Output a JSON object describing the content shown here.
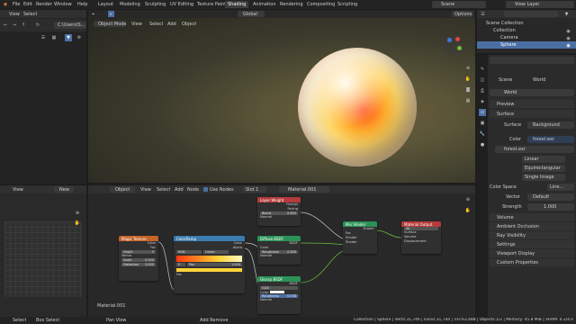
{
  "topbar": {
    "menus": [
      "File",
      "Edit",
      "Render",
      "Window",
      "Help"
    ],
    "workspaces": [
      "Layout",
      "Modeling",
      "Sculpting",
      "UV Editing",
      "Texture Paint",
      "Shading",
      "Animation",
      "Rendering",
      "Compositing",
      "Scripting"
    ],
    "active_workspace": "Shading",
    "scene": "Scene",
    "view_layer": "View Layer"
  },
  "file_browser": {
    "view_label": "View",
    "select_label": "Select",
    "path": "C:\\Users\\S..."
  },
  "viewport": {
    "mode": "Object Mode",
    "menus": [
      "View",
      "Select",
      "Add",
      "Object"
    ],
    "transform": "Global",
    "options": "Options"
  },
  "image_editor": {
    "view_label": "View",
    "new_label": "New"
  },
  "node_editor": {
    "editor_mode": "Object",
    "menus": [
      "View",
      "Select",
      "Add",
      "Node"
    ],
    "use_nodes": "Use Nodes",
    "slot": "Slot 1",
    "material": "Material.001",
    "material_footer": "Material.001"
  },
  "nodes": {
    "magic": {
      "title": "Magic Texture",
      "out_color": "Color",
      "out_fac": "Fac",
      "depth_label": "Depth",
      "depth_value": "3",
      "vector": "Vector",
      "scale_label": "Scale",
      "scale_value": "5.200",
      "distortion_label": "Distortion",
      "distortion_value": "3.000"
    },
    "ramp": {
      "title": "ColorRamp",
      "out_color": "Color",
      "out_alpha": "Alpha",
      "mode": "RGB",
      "interp": "Linear",
      "pos_label": "Pos",
      "pos_value": "1.000",
      "index": "0",
      "in_fac": "Fac"
    },
    "layer_weight": {
      "title": "Layer Weight",
      "out_fresnel": "Fresnel",
      "out_facing": "Facing",
      "blend_label": "Blend",
      "blend_value": "0.650",
      "normal": "Normal"
    },
    "diffuse": {
      "title": "Diffuse BSDF",
      "out": "BSDF",
      "color": "Color",
      "rough_label": "Roughness",
      "rough_value": "0.000",
      "normal": "Normal"
    },
    "glossy": {
      "title": "Glossy BSDF",
      "out": "BSDF",
      "dist": "GGX",
      "color": "Color",
      "rough_label": "Roughness",
      "rough_value": "0.538",
      "normal": "Normal"
    },
    "mix": {
      "title": "Mix Shader",
      "out": "Shader",
      "fac": "Fac",
      "shader1": "Shader",
      "shader2": "Shader"
    },
    "output": {
      "title": "Material Output",
      "target": "All",
      "surface": "Surface",
      "volume": "Volume",
      "displacement": "Displacement"
    }
  },
  "outliner": {
    "collection": "Scene Collection",
    "items": [
      "Collection",
      "Camera",
      "Sphere"
    ]
  },
  "properties": {
    "scene": "Scene",
    "world_tab": "World",
    "world_name": "World",
    "sections": [
      "Preview",
      "Surface"
    ],
    "surface_label": "Surface",
    "surface_value": "Background",
    "color_label": "Color",
    "color_value": "forest.exr",
    "image_name": "forest.exr",
    "interp": "Linear",
    "projection": "Equirectangular",
    "source": "Single Image",
    "color_space_label": "Color Space",
    "color_space_value": "Line...",
    "vector_label": "Vector",
    "vector_value": "Default",
    "strength_label": "Strength",
    "strength_value": "1.000",
    "lower_sections": [
      "Volume",
      "Ambient Occlusion",
      "Ray Visibility",
      "Settings",
      "Viewport Display",
      "Custom Properties"
    ]
  },
  "statusbar": {
    "select": "Select",
    "box_select": "Box Select",
    "pan_view": "Pan View",
    "add_remove": "Add Remove",
    "stats": "Collection | Sphere | Verts:31,746 | Faces:31,744 | Tris:63,488 | Objects:1/2 | Memory: 45.8 MiB | VRAM: 0.2/4.0 GiB"
  },
  "colors": {
    "accent": "#4b6fa5",
    "texture_header": "#c4632a",
    "converter_header": "#3a7bb0",
    "shader_header": "#2a9256",
    "output_header": "#b53a3a",
    "input_header": "#b53a3a"
  }
}
